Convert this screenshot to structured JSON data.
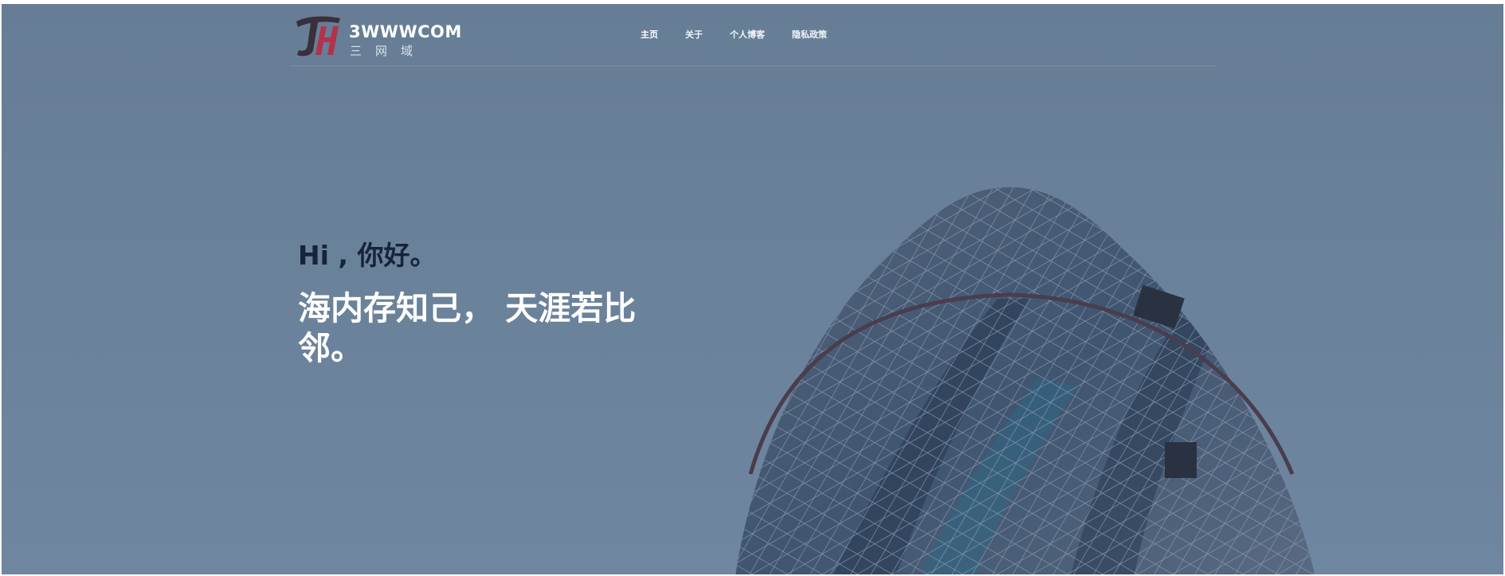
{
  "header": {
    "brand": "3WWWCOM",
    "brand_sub": "三网域",
    "nav": [
      {
        "label": "主页",
        "active": true
      },
      {
        "label": "关于",
        "active": false
      },
      {
        "label": "个人博客",
        "active": false
      },
      {
        "label": "隐私政策",
        "active": false
      }
    ]
  },
  "hero": {
    "greeting": "Hi , 你好。",
    "tagline": "海内存知己， 天涯若比邻。"
  },
  "colors": {
    "background": "#6a819a",
    "greeting_text": "#15243a",
    "tagline_text": "#ffffff",
    "logo_dark": "#3a2f3a",
    "logo_accent": "#b3324a"
  },
  "icons": {
    "logo": "jh-logo-icon",
    "background_image": "gherkin-building-photo"
  }
}
